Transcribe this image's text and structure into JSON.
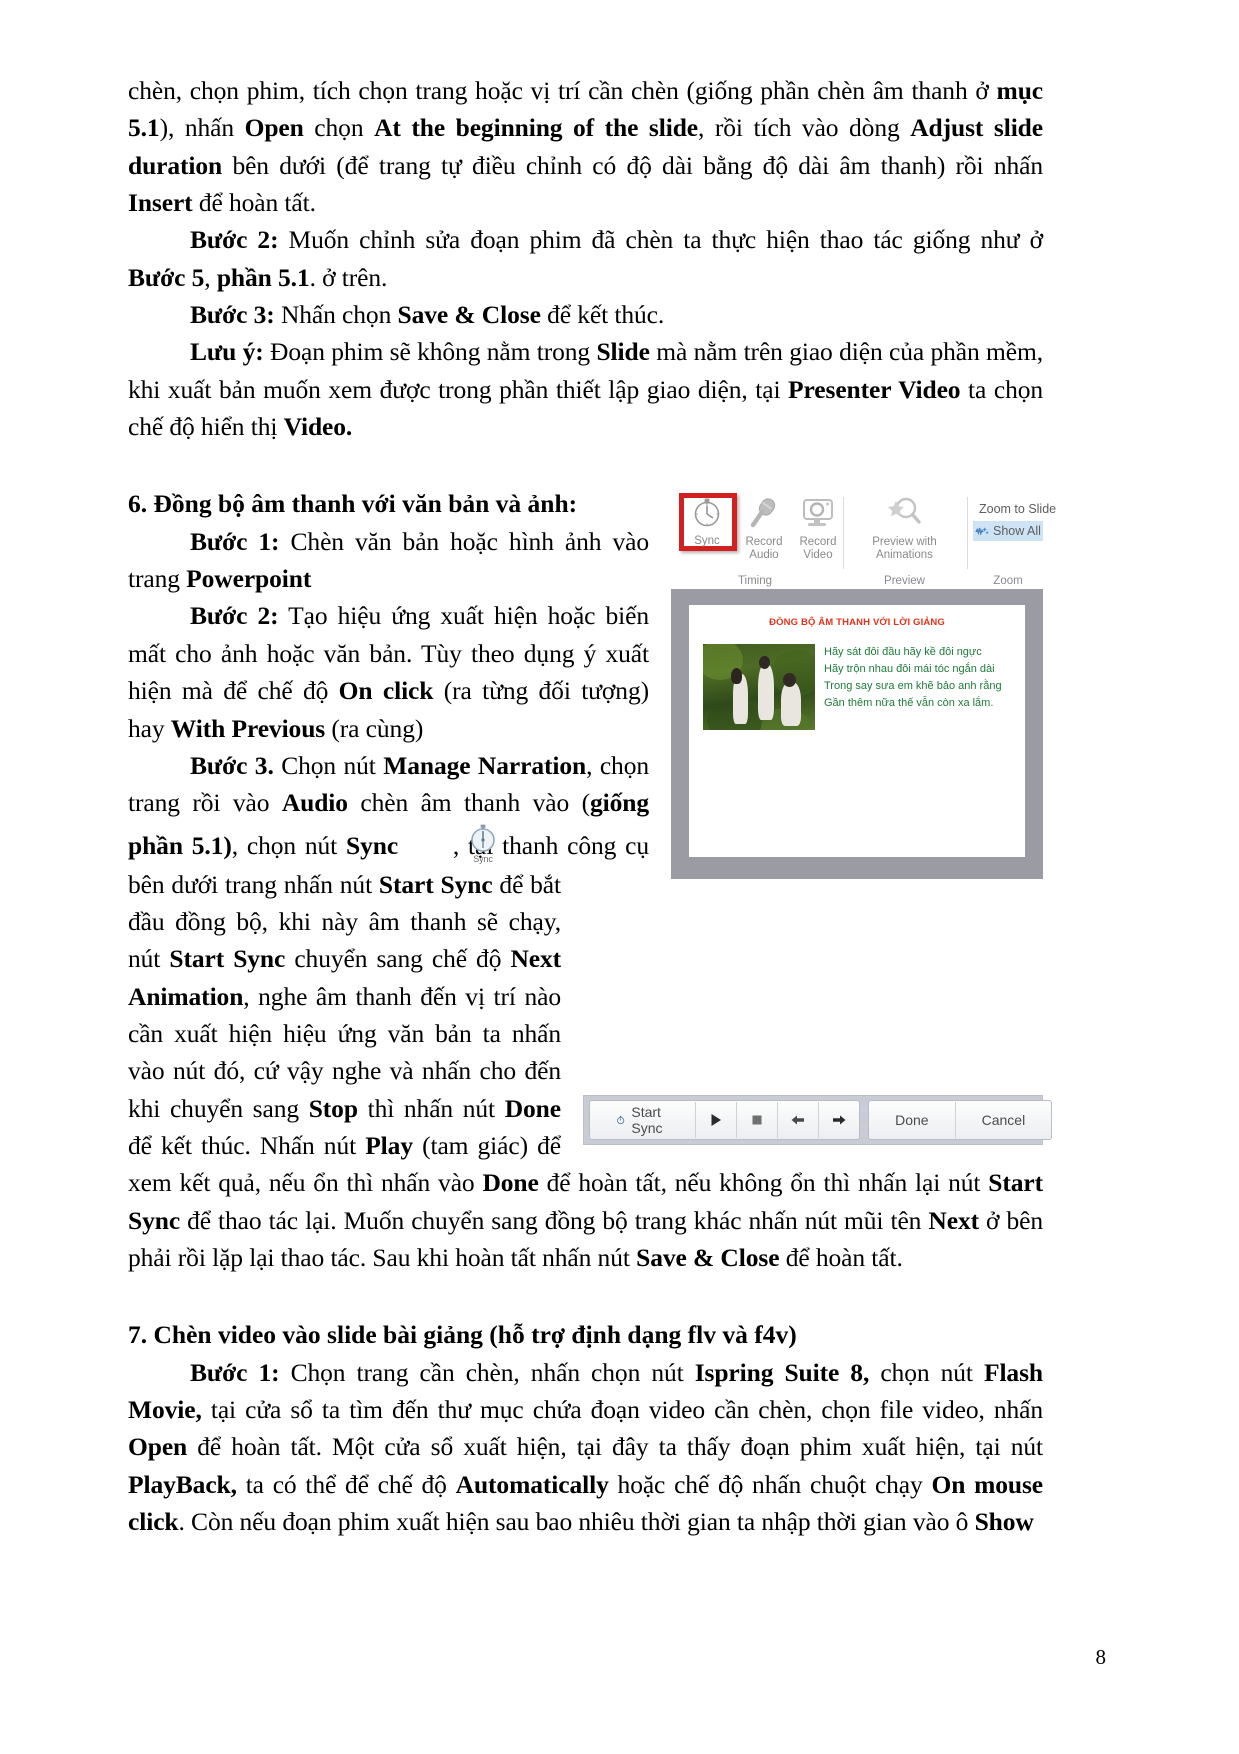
{
  "document": {
    "page_number": "8",
    "paragraphs": {
      "p1_part1": "chèn, chọn phim, tích chọn trang hoặc vị trí cần chèn (giống phần chèn âm thanh ở ",
      "p1_b1": "mục 5.1",
      "p1_part2": "), nhấn ",
      "p1_b2": "Open",
      "p1_part3": " chọn ",
      "p1_b3": "At the beginning of the slide",
      "p1_part4": ", rồi tích vào dòng ",
      "p1_b4": "Adjust slide duration",
      "p1_part5": " bên dưới (để trang tự điều chỉnh có độ dài bằng độ dài âm thanh) rồi nhấn ",
      "p1_b5": "Insert",
      "p1_part6": " để hoàn tất.",
      "p2_label": "Bước 2:",
      "p2_part1": " Muốn chỉnh sửa đoạn phim đã chèn ta thực hiện thao tác giống như ở ",
      "p2_b1": "Bước 5",
      "p2_part2": ", ",
      "p2_b2": "phần 5.1",
      "p2_part3": ". ở trên.",
      "p3_label": "Bước 3:",
      "p3_part1": " Nhấn chọn ",
      "p3_b1": "Save & Close",
      "p3_part2": " để kết thúc.",
      "p4_label": "Lưu ý:",
      "p4_part1": " Đoạn phim sẽ không nằm trong ",
      "p4_b1": "Slide",
      "p4_part2": " mà nằm trên giao diện của phần mềm, khi xuất bản muốn xem được trong phần thiết lập giao diện, tại ",
      "p4_b2": "Presenter Video",
      "p4_part3": " ta chọn chế độ hiển thị ",
      "p4_b3": "Video.",
      "section6_heading": "6. Đồng bộ âm thanh với văn bản và ảnh:",
      "p5_label": "Bước 1:",
      "p5_part1": " Chèn văn bản hoặc hình ảnh vào trang ",
      "p5_b1": "Powerpoint",
      "p6_label": "Bước 2:",
      "p6_part1": " Tạo hiệu ứng xuất hiện hoặc biến mất cho ảnh hoặc văn bản. Tùy theo dụng ý xuất hiện mà để chế độ ",
      "p6_b1": "On click",
      "p6_part2": " (ra từng đối tượng) hay ",
      "p6_b2": "With Previous",
      "p6_part3": " (ra cùng)",
      "p7_label": "Bước 3.",
      "p7_part1": " Chọn nút ",
      "p7_b1": "Manage Narration",
      "p7_part2": ", chọn trang rồi vào ",
      "p7_b2": "Audio",
      "p7_part3": " chèn âm thanh vào (",
      "p7_b3": "giống phần 5.1)",
      "p7_part4": ",   chọn nút ",
      "p7_b4": "Sync",
      "p7_part5": " , tại thanh công cụ bên dưới trang nhấn nút ",
      "p7_b5": "Start Sync",
      "p7_part6": " để bắt đầu đồng bộ, khi này âm thanh sẽ chạy, nút ",
      "p7_b6": "Start Sync",
      "p7_part7": " chuyển sang chế độ ",
      "p7_b7": "Next Animation",
      "p7_part8": ", nghe âm thanh đến vị trí nào cần xuất hiện hiệu ứng văn bản ta nhấn vào nút đó, cứ vậy nghe và nhấn cho đến khi chuyển sang ",
      "p7_b8": "Stop",
      "p7_part9": " thì nhấn nút ",
      "p7_b9": "Done",
      "p7_part10": " để kết thúc. Nhấn nút ",
      "p7_b10": "Play",
      "p7_part11": " (tam giác) để xem kết quả, nếu ổn thì nhấn vào ",
      "p7_b11": "Done",
      "p7_part12": " để hoàn tất, nếu không ổn thì nhấn lại nút ",
      "p7_b12": "Start Sync",
      "p7_part13": " để thao tác lại. Muốn chuyển sang đồng bộ trang khác nhấn nút mũi tên ",
      "p7_b13": "Next",
      "p7_part14": " ở bên phải rồi lặp lại thao tác. Sau khi hoàn tất nhấn nút ",
      "p7_b14": "Save & Close",
      "p7_part15": " để hoàn tất.",
      "section7_heading": "7. Chèn video vào slide bài giảng (hỗ trợ định dạng flv và f4v)",
      "p8_label": "Bước 1:",
      "p8_part1": " Chọn trang cần chèn, nhấn chọn nút ",
      "p8_b1": "Ispring Suite 8,",
      "p8_part2": " chọn nút ",
      "p8_b2": "Flash Movie,",
      "p8_part3": " tại cửa sổ ta tìm đến thư mục chứa đoạn video cần chèn, chọn file video, nhấn ",
      "p8_b3": "Open",
      "p8_part4": " để hoàn tất. Một cửa sổ xuất hiện, tại đây ta thấy đoạn phim xuất hiện, tại nút ",
      "p8_b4": "PlayBack,",
      "p8_part5": " ta có thể để chế độ ",
      "p8_b5": "Automatically",
      "p8_part6": " hoặc chế độ nhấn chuột chạy ",
      "p8_b6": "On mouse click",
      "p8_part7": ". Còn nếu đoạn phim xuất hiện sau bao nhiêu thời gian ta nhập thời gian vào ô ",
      "p8_b7": "Show"
    }
  },
  "ribbon_screenshot": {
    "buttons": [
      {
        "name": "sync",
        "label": "Sync",
        "highlighted": true
      },
      {
        "name": "record-audio",
        "label": "Record\nAudio",
        "highlighted": false
      },
      {
        "name": "record-video",
        "label": "Record\nVideo",
        "highlighted": false
      },
      {
        "name": "preview-with-animations",
        "label": "Preview with\nAnimations",
        "highlighted": false
      }
    ],
    "group_labels": [
      "Timing",
      "Preview",
      "Zoom"
    ],
    "zoom_items": [
      {
        "name": "zoom-to-slide",
        "label": "Zoom to Slide",
        "selected": false
      },
      {
        "name": "show-all",
        "label": "Show All",
        "selected": true
      }
    ],
    "highlight_color": "#d21f1f"
  },
  "slide_preview": {
    "title": "ĐỒNG BỘ ÂM THANH VỚI LỜI GIẢNG",
    "title_color": "#e2341d",
    "text_color": "#1f7a3c",
    "lines": [
      "Hãy sát đôi đầu hãy kề đôi ngực",
      "Hãy trộn nhau đôi mái tóc ngắn dài",
      "Trong say sưa em khẽ bảo anh rằng",
      "Gần thêm nữa thế vẫn còn xa lắm."
    ]
  },
  "sync_toolbar": {
    "start_sync_label": "Start Sync",
    "done_label": "Done",
    "cancel_label": "Cancel",
    "transport_icons": [
      "play-icon",
      "stop-icon",
      "previous-icon",
      "next-icon"
    ]
  }
}
